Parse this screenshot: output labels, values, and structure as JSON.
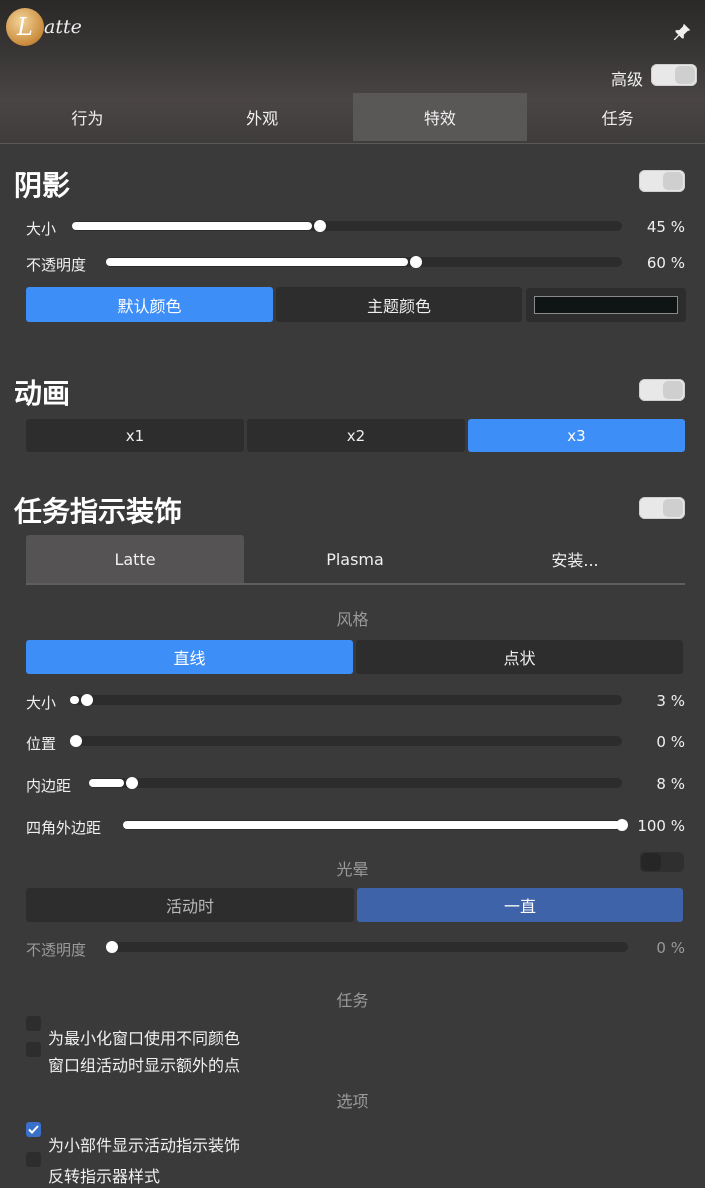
{
  "header": {
    "logo_letter": "L",
    "app_name": "atte",
    "advanced_label": "高级"
  },
  "tabs": [
    "行为",
    "外观",
    "特效",
    "任务"
  ],
  "shadow": {
    "title": "阴影",
    "size_label": "大小",
    "size_value": 45,
    "size_text": "45 %",
    "opacity_label": "不透明度",
    "opacity_value": 60,
    "opacity_text": "60 %",
    "color_buttons": [
      "默认颜色",
      "主题颜色"
    ],
    "selected_color": "#0f1414"
  },
  "animation": {
    "title": "动画",
    "options": [
      "x1",
      "x2",
      "x3"
    ],
    "selected": "x3"
  },
  "indicator": {
    "title": "任务指示装饰",
    "sources": [
      "Latte",
      "Plasma",
      "安装..."
    ],
    "style_header": "风格",
    "styles": [
      "直线",
      "点状"
    ],
    "size_label": "大小",
    "size_value": 3,
    "size_text": "3 %",
    "position_label": "位置",
    "position_value": 0,
    "position_text": "0 %",
    "padding_label": "内边距",
    "padding_value": 8,
    "padding_text": "8 %",
    "corner_label": "四角外边距",
    "corner_value": 100,
    "corner_text": "100 %",
    "glow_header": "光晕",
    "glow_modes": [
      "活动时",
      "一直"
    ],
    "glow_opacity_label": "不透明度",
    "glow_opacity_value": 0,
    "glow_opacity_text": "0 %",
    "tasks_header": "任务",
    "task_options": [
      "为最小化窗口使用不同颜色",
      "窗口组活动时显示额外的点"
    ],
    "options_header": "选项",
    "options": [
      "为小部件显示活动指示装饰",
      "反转指示器样式"
    ]
  },
  "colors": {
    "accent": "#3e8ef7",
    "accent_dim": "#3f63a8",
    "background": "#3a3a3b"
  }
}
